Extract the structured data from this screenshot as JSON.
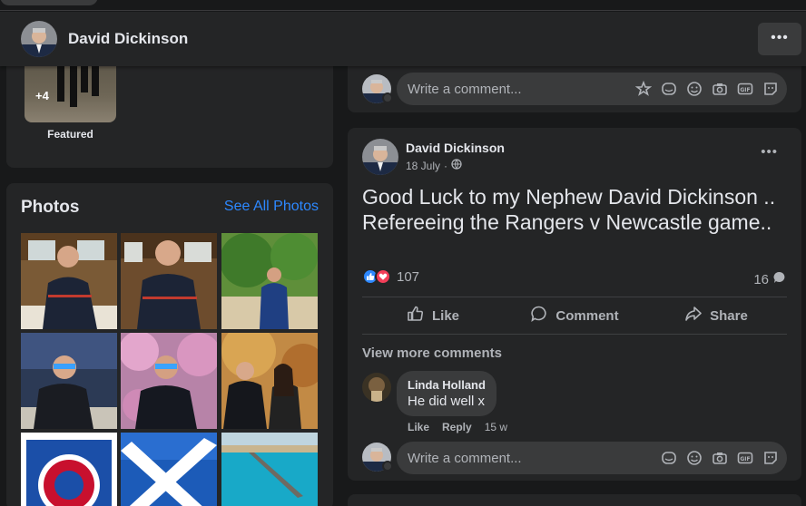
{
  "header": {
    "profile_name": "David Dickinson",
    "more_label": "•••"
  },
  "featured": {
    "overlay_count": "+4",
    "label": "Featured"
  },
  "photos": {
    "title": "Photos",
    "see_all": "See All Photos"
  },
  "composer": {
    "placeholder": "Write a comment...",
    "icons_top": [
      "avatar-sticker-icon",
      "sticker-icon",
      "emoji-icon",
      "camera-icon",
      "gif-icon",
      "sticker-face-icon"
    ],
    "icons_bottom": [
      "sticker-icon",
      "emoji-icon",
      "camera-icon",
      "gif-icon",
      "sticker-face-icon"
    ],
    "gif_label": "GIF"
  },
  "post": {
    "author": "David Dickinson",
    "date": "18 July",
    "meta_separator": "·",
    "text": "Good Luck to my Nephew David Dickinson .. Refereeing the Rangers v Newcastle game..",
    "reaction_count": "107",
    "comment_count": "16",
    "more_label": "•••",
    "actions": {
      "like": "Like",
      "comment": "Comment",
      "share": "Share"
    },
    "view_more": "View more comments",
    "reply": {
      "name": "Linda Holland",
      "text": "He did well x",
      "like": "Like",
      "reply": "Reply",
      "time": "15 w"
    }
  },
  "colors": {
    "background": "#18191a",
    "card": "#242526",
    "input": "#3a3b3c",
    "link": "#2d88ff",
    "like_blue": "#2d88ff",
    "love_red": "#f33e58"
  }
}
